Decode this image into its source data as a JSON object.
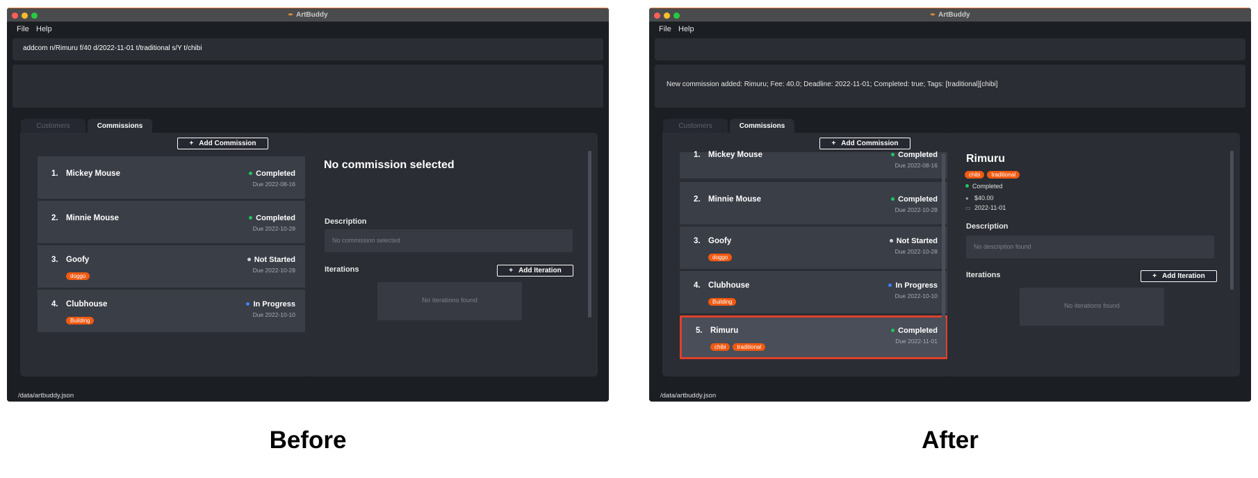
{
  "colors": {
    "completed": "#22c55e",
    "not_started": "#d4d4d4",
    "in_progress": "#3b82f6",
    "tag": "#f05a12",
    "highlight": "#e0402c"
  },
  "before": {
    "window_title": "ArtBuddy",
    "menu": {
      "file": "File",
      "help": "Help"
    },
    "command_input": "addcom n/Rimuru f/40 d/2022-11-01 t/traditional s/Y t/chibi",
    "result": "",
    "tabs": {
      "customers": "Customers",
      "commissions": "Commissions"
    },
    "add_commission": "Add Commission",
    "commissions": [
      {
        "index": "1.",
        "name": "Mickey Mouse",
        "status": "Completed",
        "due": "Due 2022-08-16",
        "tags": []
      },
      {
        "index": "2.",
        "name": "Minnie Mouse",
        "status": "Completed",
        "due": "Due 2022-10-28",
        "tags": []
      },
      {
        "index": "3.",
        "name": "Goofy",
        "status": "Not Started",
        "due": "Due 2022-10-28",
        "tags": [
          "doggo"
        ]
      },
      {
        "index": "4.",
        "name": "Clubhouse",
        "status": "In Progress",
        "due": "Due 2022-10-10",
        "tags": [
          "Building"
        ]
      }
    ],
    "detail": {
      "title": "No commission selected",
      "description_label": "Description",
      "description": "No commission selected",
      "iterations_label": "Iterations",
      "add_iteration": "Add Iteration",
      "no_iterations": "No iterations found"
    },
    "status_path": "/data/artbuddy.json"
  },
  "after": {
    "window_title": "ArtBuddy",
    "menu": {
      "file": "File",
      "help": "Help"
    },
    "command_input": "",
    "result": "New commission added: Rimuru; Fee: 40.0; Deadline: 2022-11-01; Completed: true; Tags: [traditional][chibi]",
    "tabs": {
      "customers": "Customers",
      "commissions": "Commissions"
    },
    "add_commission": "Add Commission",
    "commissions": [
      {
        "index": "1.",
        "name": "Mickey Mouse",
        "status": "Completed",
        "due": "Due 2022-08-16",
        "tags": []
      },
      {
        "index": "2.",
        "name": "Minnie Mouse",
        "status": "Completed",
        "due": "Due 2022-10-28",
        "tags": []
      },
      {
        "index": "3.",
        "name": "Goofy",
        "status": "Not Started",
        "due": "Due 2022-10-28",
        "tags": [
          "doggo"
        ]
      },
      {
        "index": "4.",
        "name": "Clubhouse",
        "status": "In Progress",
        "due": "Due 2022-10-10",
        "tags": [
          "Building"
        ]
      },
      {
        "index": "5.",
        "name": "Rimuru",
        "status": "Completed",
        "due": "Due 2022-11-01",
        "tags": [
          "chibi",
          "traditional"
        ]
      }
    ],
    "detail": {
      "name": "Rimuru",
      "tags": [
        "chibi",
        "traditional"
      ],
      "status": "Completed",
      "fee": "$40.00",
      "deadline": "2022-11-01",
      "description_label": "Description",
      "description": "No description found",
      "iterations_label": "Iterations",
      "add_iteration": "Add Iteration",
      "no_iterations": "No iterations found"
    },
    "status_path": "/data/artbuddy.json"
  },
  "captions": {
    "before": "Before",
    "after": "After"
  }
}
